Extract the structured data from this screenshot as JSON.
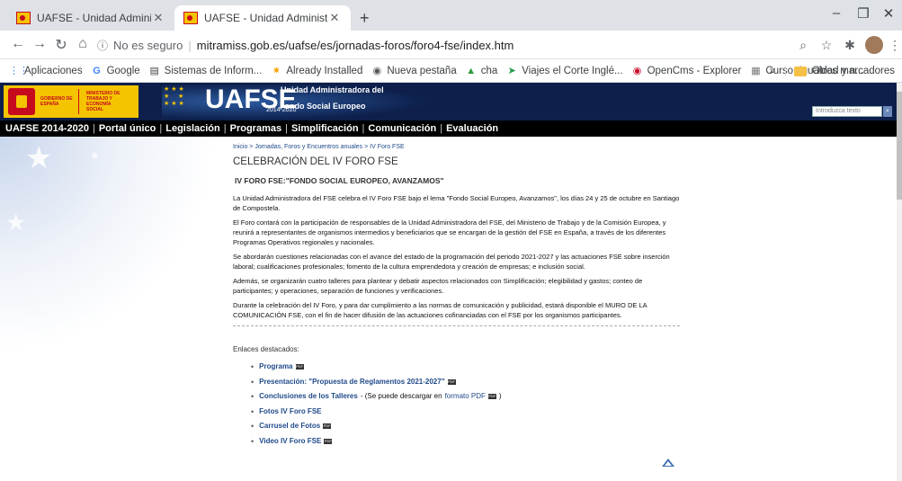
{
  "browser": {
    "tabs": [
      {
        "title": "UAFSE - Unidad Administradora d",
        "active": false
      },
      {
        "title": "UAFSE - Unidad Administradora d",
        "active": true
      }
    ],
    "new_tab": "+",
    "address": {
      "security": "No es seguro",
      "url": "mitramiss.gob.es/uafse/es/jornadas-foros/foro4-fse/index.htm"
    },
    "bookmarks": [
      {
        "label": "Aplicaciones",
        "icon": "apps-grid-icon"
      },
      {
        "label": "Google",
        "icon": "google-icon"
      },
      {
        "label": "Sistemas de Inform...",
        "icon": "doc-icon"
      },
      {
        "label": "Already Installed",
        "icon": "sun-icon"
      },
      {
        "label": "Nueva pestaña",
        "icon": "chrome-icon"
      },
      {
        "label": "cha",
        "icon": "triangle-icon"
      },
      {
        "label": "Viajes el Corte Inglé...",
        "icon": "arrow-icon"
      },
      {
        "label": "OpenCms - Explorer",
        "icon": "opencms-icon"
      },
      {
        "label": "Curso: Igualdad y n...",
        "icon": "course-icon"
      }
    ],
    "bookmarks_more": "»",
    "other_bookmarks": "Otros marcadores"
  },
  "site": {
    "gov_text": "GOBIERNO DE ESPAÑA",
    "ministry_text": "MINISTERIO DE TRABAJO Y ECONOMÍA SOCIAL",
    "logo": "UAFSE",
    "logo_sub": "Unidad Administradora del",
    "logo_sub2": "Fondo Social Europeo",
    "logo_years": "2014-2020",
    "search_placeholder": "Introduzca texto",
    "menu": [
      "UAFSE 2014-2020",
      "Portal único",
      "Legislación",
      "Programas",
      "Simplificación",
      "Comunicación",
      "Evaluación"
    ]
  },
  "content": {
    "breadcrumb": "Inicio > Jornadas, Foros y Encuentros anuales > IV Foro FSE",
    "title": "CELEBRACIÓN DEL IV FORO FSE",
    "subtitle": "IV FORO FSE:\"FONDO SOCIAL EUROPEO, AVANZAMOS\"",
    "paragraphs": [
      "La Unidad Administradora del FSE celebra el IV Foro FSE bajo el lema \"Fondo Social Europeo, Avanzamos\", los días 24 y 25 de octubre en Santiago de Compostela.",
      "El Foro contará con la participación de responsables de la Unidad Administradora del FSE, del Ministerio de Trabajo y de la Comisión Europea, y reunirá a representantes de organismos intermedios y beneficiarios que se encargan de la gestión del FSE en España, a través de los diferentes Programas Operativos regionales y nacionales.",
      "Se abordarán cuestiones relacionadas con el avance del estado de la programación del periodo 2021-2027 y las actuaciones FSE sobre inserción laboral; cualificaciones profesionales; fomento de la cultura emprendedora y creación de empresas; e inclusión social.",
      "Además, se organizarán cuatro talleres para plantear y debatir aspectos relacionados con Simplificación; elegibilidad y gastos; conteo de participantes; y operaciones, separación de funciones y verificaciones.",
      "Durante la celebración del IV Foro, y para dar cumplimiento a las normas de comunicación y publicidad, estará disponible el MURO DE LA COMUNICACIÓN FSE, con el fin de hacer difusión de las actuaciones cofinanciadas con el FSE por los organismos participantes."
    ],
    "links_title": "Enlaces destacados:",
    "links": {
      "programa": "Programa",
      "presentacion": "Presentación: \"Propuesta de Reglamentos 2021-2027\"",
      "conclusiones": "Conclusiones de los Talleres",
      "conclusiones_note": "- (Se puede descargar en",
      "conclusiones_link": "formato PDF",
      "conclusiones_end": ")",
      "fotos": "Fotos IV Foro FSE",
      "carrusel": "Carrusel de Fotos",
      "video": "Video IV Foro FSE"
    },
    "pdf_badge": "PDF"
  }
}
